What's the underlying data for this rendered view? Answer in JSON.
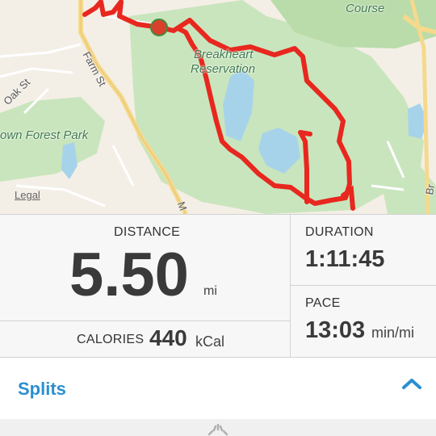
{
  "map": {
    "park_label_1": "Breakheart",
    "park_label_2": "Reservation",
    "forest_park_label": "own Forest Park",
    "course_label": "Course",
    "street_oak": "Oak St",
    "street_farm": "Farm St",
    "street_m": "M",
    "street_br": "Br",
    "legal_link": "Legal",
    "colors": {
      "route": "#e8271f",
      "park": "#c9e5bd",
      "water": "#a7d3ea",
      "land": "#f4efe6",
      "road": "#ffffff",
      "major_road": "#f5d98c"
    }
  },
  "stats": {
    "distance_label": "DISTANCE",
    "distance_value": "5.50",
    "distance_unit": "mi",
    "duration_label": "DURATION",
    "duration_value": "1:11:45",
    "pace_label": "PACE",
    "pace_value": "13:03",
    "pace_unit": "min/mi",
    "calories_label": "CALORIES",
    "calories_value": "440",
    "calories_unit": "kCal"
  },
  "splits": {
    "label": "Splits",
    "expand_icon": "chevron-up-icon",
    "accent_color": "#2b8fd0"
  },
  "loading": {
    "icon": "spinner-icon"
  }
}
